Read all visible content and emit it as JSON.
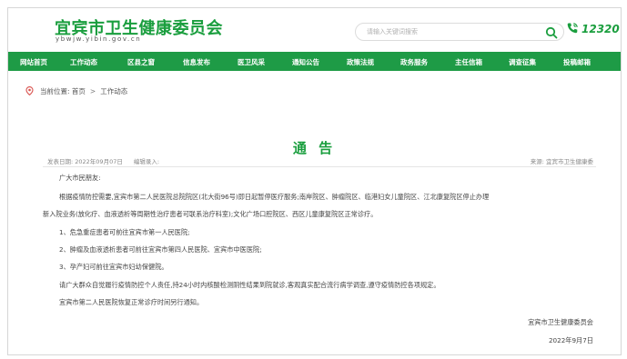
{
  "header": {
    "title": "宜宾市卫生健康委员会",
    "domain": "ybwjw.yibin.gov.cn",
    "search_placeholder": "请输入关键词搜索",
    "hotline": "12320"
  },
  "nav": {
    "items": [
      {
        "label": "网站首页"
      },
      {
        "label": "工作动态"
      },
      {
        "label": "区县之窗"
      },
      {
        "label": "信息发布"
      },
      {
        "label": "医卫风采"
      },
      {
        "label": "通知公告"
      },
      {
        "label": "政策法规"
      },
      {
        "label": "政务服务"
      },
      {
        "label": "主任信箱"
      },
      {
        "label": "调查征集"
      },
      {
        "label": "投稿邮箱"
      }
    ]
  },
  "breadcrumb": {
    "prefix": "当前位置:",
    "home": "首页",
    "separator": ">",
    "current": "工作动态"
  },
  "article": {
    "title": "通 告",
    "date_label": "发表日期: 2022年09月07日",
    "editor_label": "编辑录入:",
    "source_label": "来源: 宜宾市卫生健康委",
    "greeting": "广大市民朋友:",
    "p1_line1": "根据疫情防控需要,宜宾市第二人民医院总院院区(北大街96号)即日起暂停医疗服务;南岸院区、肿瘤院区、临港妇女儿童院区、江北康复院区停止办理",
    "p1_line2": "新入院业务(放化疗、血液透析等周期性治疗患者可联系治疗科室);文化广场口腔院区、西区儿童康复院区正常诊疗。",
    "item1": "1、危急重症患者可前往宜宾市第一人民医院;",
    "item2": "2、肿瘤及血液透析患者可前往宜宾市第四人民医院、宜宾市中医医院;",
    "item3": "3、孕产妇可前往宜宾市妇幼保健院。",
    "p2": "请广大群众自觉履行疫情防控个人责任,持24小时内核酸检测阴性结果到院就诊,客观真实配合流行病学调查,遵守疫情防控各项规定。",
    "p3": "宜宾市第二人民医院恢复正常诊疗时间另行通知。",
    "sign_org": "宜宾市卫生健康委员会",
    "sign_date": "2022年9月7日"
  },
  "colors": {
    "brand_green": "#1a9e3e",
    "nav_green": "#1e9b46"
  },
  "icons": [
    "search-icon",
    "phone-icon",
    "location-icon"
  ]
}
